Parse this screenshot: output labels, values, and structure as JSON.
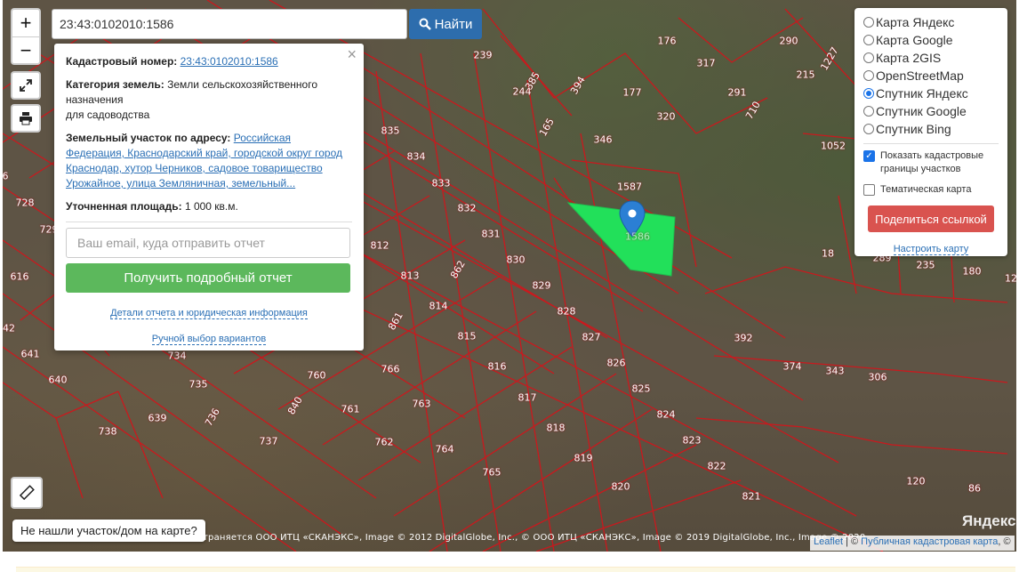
{
  "search": {
    "value": "23:43:0102010:1586",
    "button_label": "Найти"
  },
  "zoom": {
    "in_label": "+",
    "out_label": "−"
  },
  "popup": {
    "cad_label": "Кадастровый номер:",
    "cad_value": "23:43:0102010:1586",
    "category_label": "Категория земель:",
    "category_value": "Земли сельскохозяйственного назначения",
    "category_use": "для садоводства",
    "address_label": "Земельный участок по адресу:",
    "address_value": "Российская Федерация, Краснодарский край, городской округ город Краснодар, хутор Черников, садовое товарищество Урожайное, улица Земляничная, земельный...",
    "area_label": "Уточненная площадь:",
    "area_value": "1 000 кв.м.",
    "email_placeholder": "Ваш email, куда отправить отчет",
    "report_button": "Получить подробный отчет",
    "details_link": "Детали отчета и юридическая информация",
    "manual_link": "Ручной выбор вариантов",
    "close": "×"
  },
  "layers": {
    "options": [
      {
        "label": "Карта Яндекс",
        "selected": false
      },
      {
        "label": "Карта Google",
        "selected": false
      },
      {
        "label": "Карта 2GIS",
        "selected": false
      },
      {
        "label": "OpenStreetMap",
        "selected": false
      },
      {
        "label": "Спутник Яндекс",
        "selected": true
      },
      {
        "label": "Спутник Google",
        "selected": false
      },
      {
        "label": "Спутник Bing",
        "selected": false
      }
    ],
    "show_borders_label": "Показать кадастровые границы участков",
    "show_borders_checked": true,
    "thematic_label": "Тематическая карта",
    "thematic_checked": false,
    "share_button": "Поделиться ссылкой",
    "configure_link": "Настроить карту"
  },
  "not_found_button": "Не нашли участок/дом на карте?",
  "attribution": "траняется ООО ИТЦ «СКАНЭКС», Image © 2012 DigitalGlobe, Inc., © ООО ИТЦ «СКАНЭКС», Image © 2019 DigitalGlobe, Inc., Image © 2020",
  "attribution_links": {
    "leaflet": "Leaflet",
    "sep": " | © ",
    "pkk": "Публичная кадастровая карта",
    "tail": ", ©"
  },
  "yandex_logo": "Яндекс",
  "selected_parcel_label": "1586",
  "parcel_labels": [
    "239",
    "176",
    "290",
    "1227",
    "317",
    "385",
    "394",
    "244",
    "177",
    "291",
    "215",
    "1052",
    "320",
    "710",
    "346",
    "165",
    "1587",
    "835",
    "834",
    "833",
    "832",
    "831",
    "830",
    "829",
    "828",
    "827",
    "826",
    "825",
    "824",
    "823",
    "822",
    "821",
    "820",
    "819",
    "818",
    "817",
    "816",
    "815",
    "814",
    "813",
    "812",
    "862",
    "861",
    "734",
    "735",
    "736",
    "737",
    "738",
    "639",
    "640",
    "641",
    "616",
    "728",
    "729",
    "760",
    "761",
    "762",
    "763",
    "764",
    "765",
    "766",
    "840",
    "392",
    "374",
    "343",
    "306",
    "18",
    "289",
    "235",
    "180",
    "120",
    "86",
    "12",
    "42",
    "6"
  ],
  "colors": {
    "parcel_line": "#d0161c",
    "selected_fill": "#22e05a",
    "marker": "#2b7fd4",
    "find_button": "#2d6dad",
    "report_button": "#5cb85c",
    "share_button": "#d9534f"
  },
  "icons": {
    "search": "search-icon",
    "fullscreen": "fullscreen-icon",
    "print": "print-icon",
    "ruler": "ruler-icon",
    "marker": "map-marker-icon"
  }
}
